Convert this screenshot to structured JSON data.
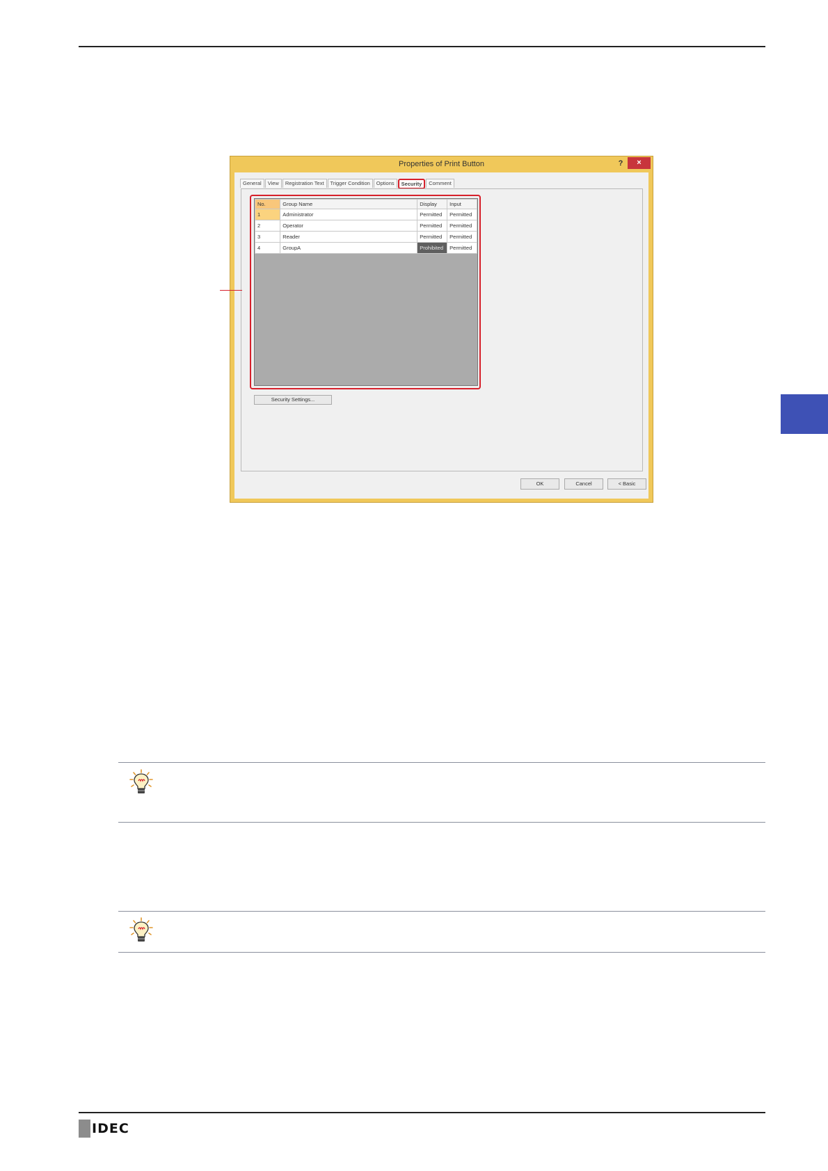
{
  "dialog": {
    "title": "Properties of Print Button",
    "help_label": "?",
    "close_label": "×",
    "tabs": [
      {
        "label": "General"
      },
      {
        "label": "View"
      },
      {
        "label": "Registration Text"
      },
      {
        "label": "Trigger Condition"
      },
      {
        "label": "Options"
      },
      {
        "label": "Security"
      },
      {
        "label": "Comment"
      }
    ],
    "active_tab": "Security",
    "grid": {
      "headers": [
        "No.",
        "Group Name",
        "Display",
        "Input"
      ],
      "rows": [
        {
          "no": "1",
          "name": "Administrator",
          "display": "Permitted",
          "input": "Permitted"
        },
        {
          "no": "2",
          "name": "Operator",
          "display": "Permitted",
          "input": "Permitted"
        },
        {
          "no": "3",
          "name": "Reader",
          "display": "Permitted",
          "input": "Permitted"
        },
        {
          "no": "4",
          "name": "GroupA",
          "display": "Prohibited",
          "input": "Permitted"
        }
      ]
    },
    "security_settings_label": "Security Settings...",
    "ok_label": "OK",
    "cancel_label": "Cancel",
    "basic_label": "< Basic"
  },
  "footer": {
    "logo_text": "IDEC"
  },
  "colors": {
    "accent_red": "#d6202b",
    "side_tab_blue": "#3e51b5",
    "dialog_frame": "#f0c85a"
  }
}
